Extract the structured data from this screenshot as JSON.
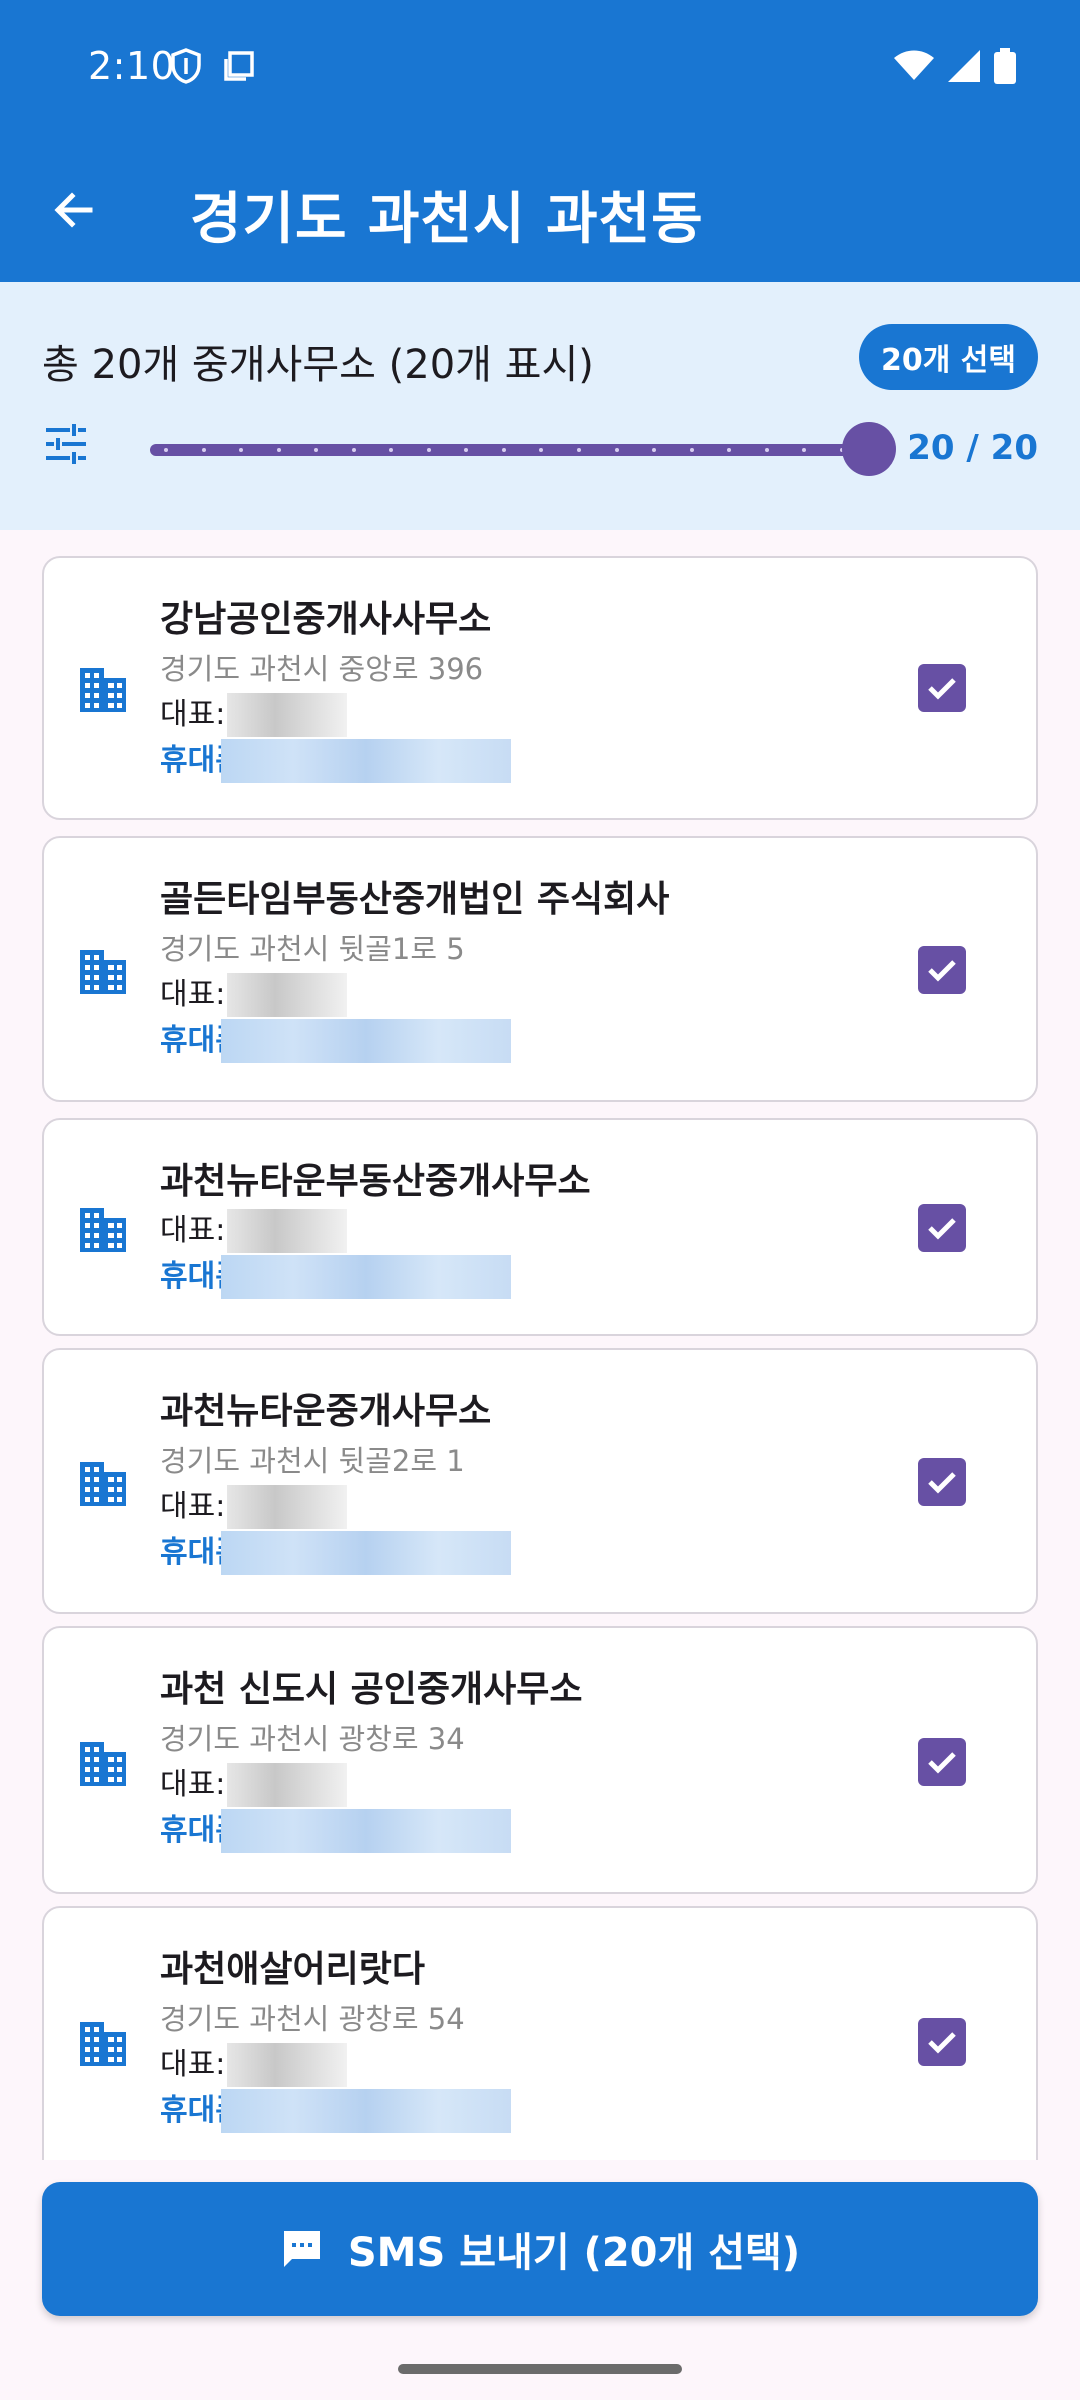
{
  "status_bar": {
    "time": "2:10",
    "icons_left": [
      "shield-icon",
      "screen-icon"
    ],
    "icons_right": [
      "wifi-icon",
      "signal-icon",
      "battery-icon"
    ]
  },
  "app_bar": {
    "title": "경기도 과천시 과천동",
    "back_icon": "arrow-back-icon"
  },
  "summary": {
    "text": "총 20개 중개사무소 (20개 표시)",
    "badge": "20개 선택",
    "slider_value_text": "20 / 20",
    "slider_fraction": 1.0
  },
  "offices": [
    {
      "name": "강남공인중개사사무소",
      "address": "경기도 과천시 중앙로 396",
      "rep_label": "대표:",
      "phone_label": "휴대폰",
      "checked": true
    },
    {
      "name": "골든타임부동산중개법인 주식회사",
      "address": "경기도 과천시 뒷골1로 5",
      "rep_label": "대표:",
      "phone_label": "휴대폰",
      "checked": true
    },
    {
      "name": "과천뉴타운부동산중개사무소",
      "address": "",
      "rep_label": "대표:",
      "phone_label": "휴대폰",
      "checked": true
    },
    {
      "name": "과천뉴타운중개사무소",
      "address": "경기도 과천시 뒷골2로 1",
      "rep_label": "대표:",
      "phone_label": "휴대폰",
      "checked": true
    },
    {
      "name": "과천 신도시 공인중개사무소",
      "address": "경기도 과천시 광창로 34",
      "rep_label": "대표:",
      "phone_label": "휴대폰",
      "checked": true
    },
    {
      "name": "과천애살어리랏다",
      "address": "경기도 과천시 광창로 54",
      "rep_label": "대표:",
      "phone_label": "휴대폰",
      "checked": true
    }
  ],
  "sms_button": {
    "label": "SMS 보내기 (20개 선택)",
    "icon": "sms-icon"
  },
  "colors": {
    "primary": "#1976d2",
    "accent": "#6750a4",
    "summary_bg": "#e3f0fc"
  }
}
